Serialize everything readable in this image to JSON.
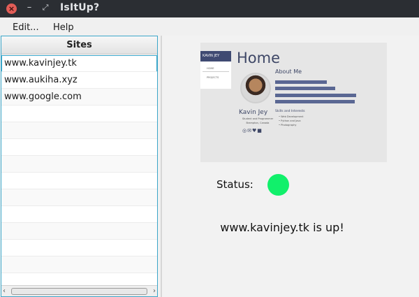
{
  "window": {
    "title": "IsItUp?",
    "close_icon": "×",
    "minimize_icon": "–",
    "maximize_icon": "⤢"
  },
  "menu": {
    "edit": "Edit...",
    "help": "Help"
  },
  "sites": {
    "header": "Sites",
    "items": [
      "www.kavinjey.tk",
      "www.aukiha.xyz",
      "www.google.com"
    ],
    "selected": "www.kavinjey.tk"
  },
  "preview": {
    "nav_title": "KAVIN JEY",
    "nav_home": "HOME",
    "nav_projects": "PROJECTS",
    "heading": "Home",
    "name": "Kavin Jey",
    "subtitle1": "Student and Programmer",
    "subtitle2": "Brampton, Canada",
    "social": "◎✉♥■",
    "about": "About Me",
    "skills": "Skills and Interests",
    "skill1": "• Web Development",
    "skill2": "• Python and Java",
    "skill3": "• Photography"
  },
  "status": {
    "label": "Status:",
    "state": "up",
    "color": "#11f06b",
    "message": "www.kavinjey.tk is up!"
  },
  "scrollbar": {
    "left_icon": "‹",
    "right_icon": "›"
  },
  "colors": {
    "titlebar": "#2b2e33",
    "close": "#e25d57",
    "accent": "#3ba6c9"
  }
}
